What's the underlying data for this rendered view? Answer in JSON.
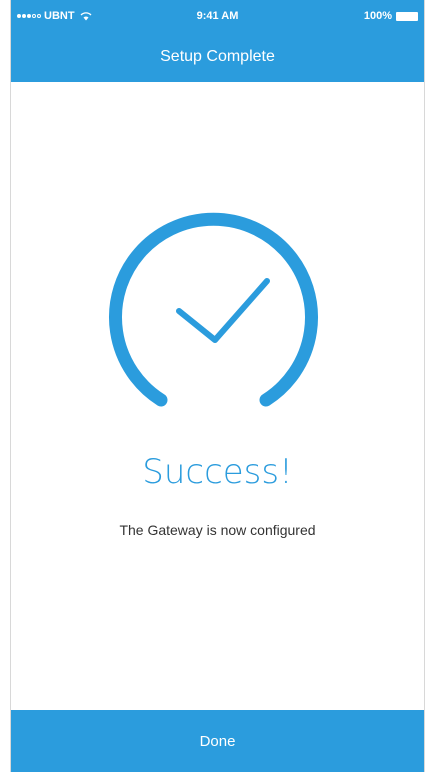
{
  "status_bar": {
    "carrier": "UBNT",
    "time": "9:41 AM",
    "battery": "100%"
  },
  "header": {
    "title": "Setup Complete"
  },
  "main": {
    "icon": "checkmark-circle-icon",
    "title": "Success!",
    "subtitle": "The Gateway is now configured"
  },
  "footer": {
    "done_label": "Done"
  },
  "colors": {
    "accent": "#2b9cdd",
    "background": "#ffffff",
    "text": "#333333"
  }
}
